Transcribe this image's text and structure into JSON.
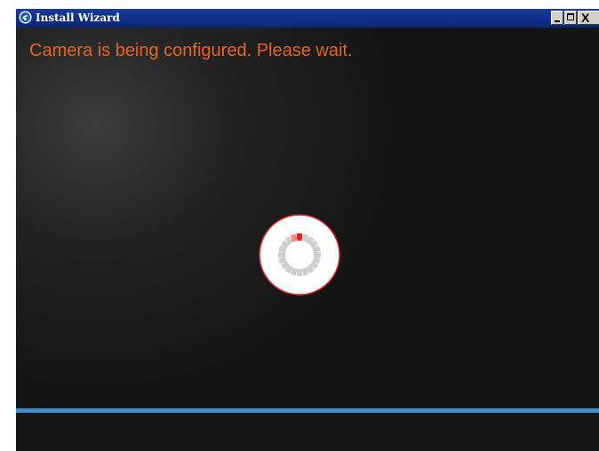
{
  "window": {
    "title": "Install Wizard",
    "icons": {
      "app": "app-logo-icon",
      "minimize": "minimize-icon",
      "maximize": "maximize-icon",
      "close": "close-icon"
    },
    "controls": {
      "close_glyph": "X"
    }
  },
  "main": {
    "status_message": "Camera is being configured. Please wait.",
    "status_color": "#e8641e"
  },
  "spinner": {
    "icon": "loading-spinner-icon",
    "segments": 20,
    "active_segment": 0,
    "active_color": "#e62020",
    "trail_color": "#ff8a8a",
    "inactive_color": "#cfcfcf",
    "ring_color": "#d9232a"
  },
  "colors": {
    "accent_bar": "#3a8fcc",
    "titlebar": "#0f2e86",
    "background": "#141414"
  }
}
